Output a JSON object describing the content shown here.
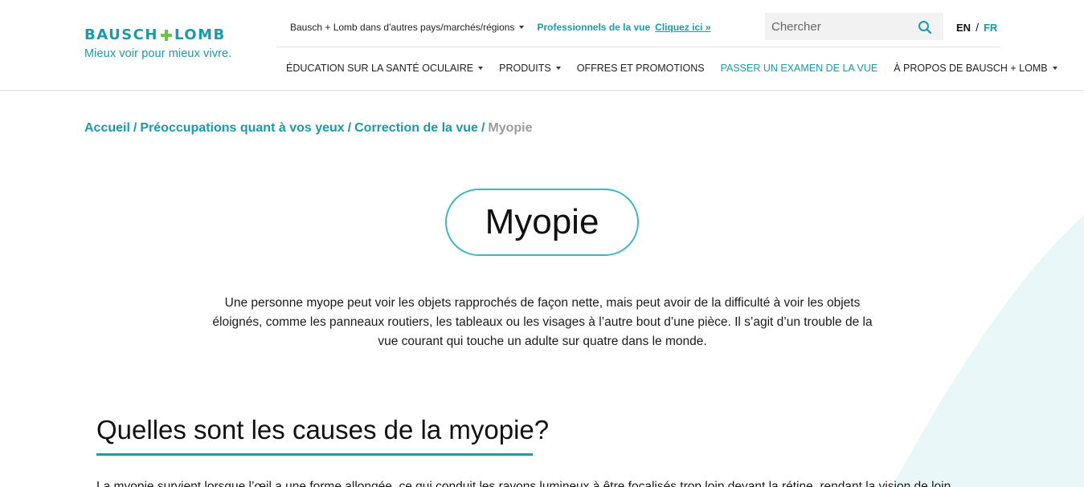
{
  "colors": {
    "accent": "#1b9aaa",
    "plus": "#6cc24a",
    "muted": "#9b9b9b"
  },
  "logo": {
    "wordmark_left": "BAUSCH",
    "wordmark_right": "LOMB",
    "tagline": "Mieux voir pour mieux vivre."
  },
  "topbar": {
    "region_label": "Bausch + Lomb dans d'autres pays/marchés/régions",
    "professionals_label": "Professionnels de la vue",
    "professionals_link": "Cliquez ici »"
  },
  "search": {
    "placeholder": "Chercher",
    "icon": "search-icon"
  },
  "language": {
    "en": "EN",
    "separator": "/",
    "fr": "FR",
    "active": "FR"
  },
  "nav": {
    "items": [
      {
        "label": "ÉDUCATION SUR LA SANTÉ OCULAIRE",
        "dropdown": true
      },
      {
        "label": "PRODUITS",
        "dropdown": true
      },
      {
        "label": "OFFRES ET PROMOTIONS",
        "dropdown": false
      },
      {
        "label": "PASSER UN EXAMEN DE LA VUE",
        "dropdown": false
      },
      {
        "label": "À PROPOS DE BAUSCH + LOMB",
        "dropdown": true
      }
    ]
  },
  "breadcrumb": {
    "items": [
      "Accueil",
      "Préoccupations quant à vos yeux",
      "Correction de la vue"
    ],
    "separator": "/",
    "current": "Myopie"
  },
  "page": {
    "title": "Myopie",
    "intro": "Une personne myope peut voir les objets rapprochés de façon nette, mais peut avoir de la difficulté à voir les objets éloignés, comme les panneaux routiers, les tableaux ou les visages à l’autre bout d’une pièce. Il s’agit d’un trouble de la vue courant qui touche un adulte sur quatre dans le monde.",
    "section_heading": "Quelles sont les causes de la myopie?",
    "section_text": "La myopie survient lorsque l’œil a une forme allongée, ce qui conduit les rayons lumineux à être focalisés trop loin devant la rétine, rendant la vision de loin"
  }
}
